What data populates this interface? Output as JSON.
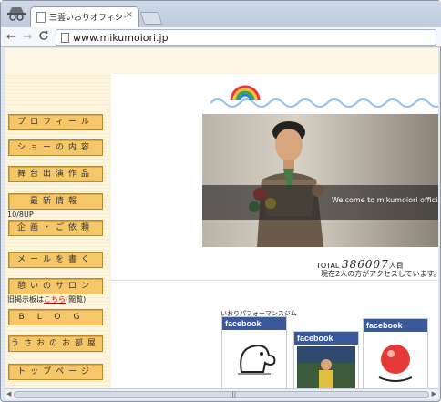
{
  "tab": {
    "title": "三雲いおりオフィシャルサ",
    "close": "×"
  },
  "toolbar": {
    "back": "←",
    "forward": "→",
    "reload": "C",
    "url": "www.mikumoiori.jp"
  },
  "sidebar": {
    "items": [
      {
        "label": "プロフィール"
      },
      {
        "label": "ショーの内容"
      },
      {
        "label": "舞台出演作品"
      },
      {
        "label": "最新情報"
      },
      {
        "label": "企画・ご依頼"
      },
      {
        "label": "メールを書く"
      },
      {
        "label": "憩いのサロン"
      },
      {
        "label": "BLOG"
      },
      {
        "label": "うさおのお部屋"
      },
      {
        "label": "トップページ"
      }
    ],
    "update_note": "10/8UP",
    "bbs_note_prefix": "旧掲示板は",
    "bbs_note_link": "こちら",
    "bbs_note_suffix": "(閲覧)"
  },
  "main": {
    "banner_text": "Welcome to mikumoiori official websi",
    "counter_label": "TOTAL",
    "counter_value": "386007",
    "counter_unit": "人目",
    "visitors_now": "現在2人の方がアクセスしています。",
    "fb_caption": "いおりパフォーマンスジム",
    "facebook_label": "facebook"
  },
  "colors": {
    "menu_button": "#f6c769",
    "facebook": "#3b5998",
    "sidebar_bg": "#fdf6e2"
  }
}
